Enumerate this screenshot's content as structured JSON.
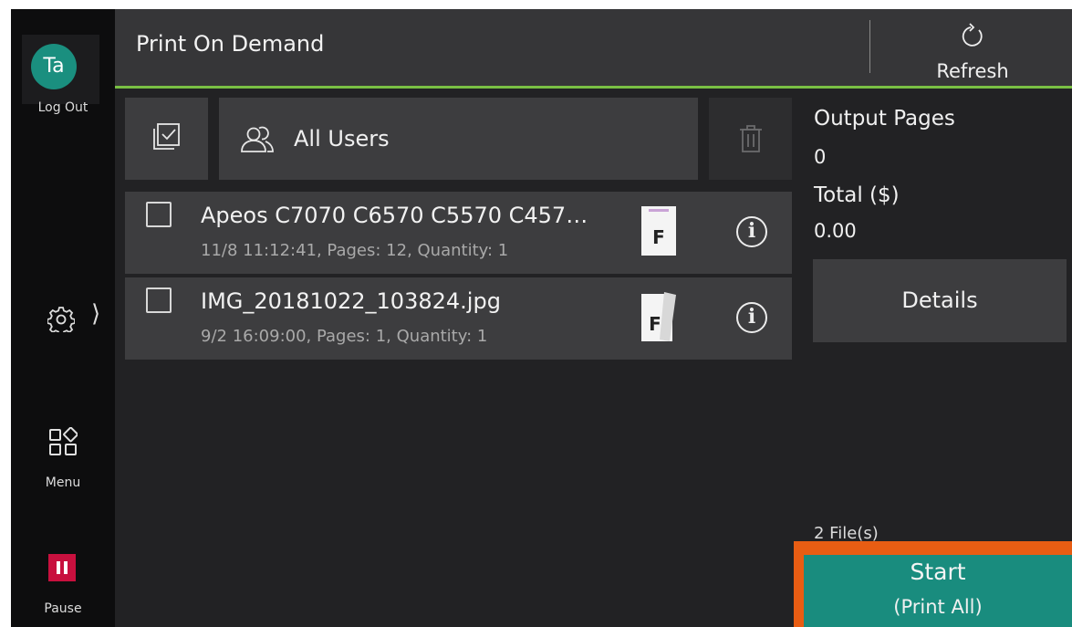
{
  "user": {
    "initials": "Ta",
    "logout_label": "Log Out"
  },
  "rail": {
    "menu_label": "Menu",
    "pause_label": "Pause"
  },
  "header": {
    "title": "Print On Demand",
    "refresh_label": "Refresh"
  },
  "toolbar": {
    "users_label": "All Users"
  },
  "files": [
    {
      "name": "Apeos C7070 C6570 C5570 C457…",
      "meta": "11/8 11:12:41, Pages: 12, Quantity: 1",
      "thumb_letter": "F"
    },
    {
      "name": "IMG_20181022_103824.jpg",
      "meta": "9/2 16:09:00, Pages: 1, Quantity: 1",
      "thumb_letter": "F"
    }
  ],
  "summary": {
    "output_pages_label": "Output Pages",
    "output_pages_value": "0",
    "total_label": "Total ($)",
    "total_value": "0.00",
    "details_label": "Details",
    "files_count": "2 File(s)",
    "start_label": "Start",
    "start_sub": "(Print All)"
  },
  "colors": {
    "accent_green": "#79c043",
    "teal": "#198c7e",
    "pause_red": "#c8103e",
    "highlight_orange": "#e85d13"
  }
}
